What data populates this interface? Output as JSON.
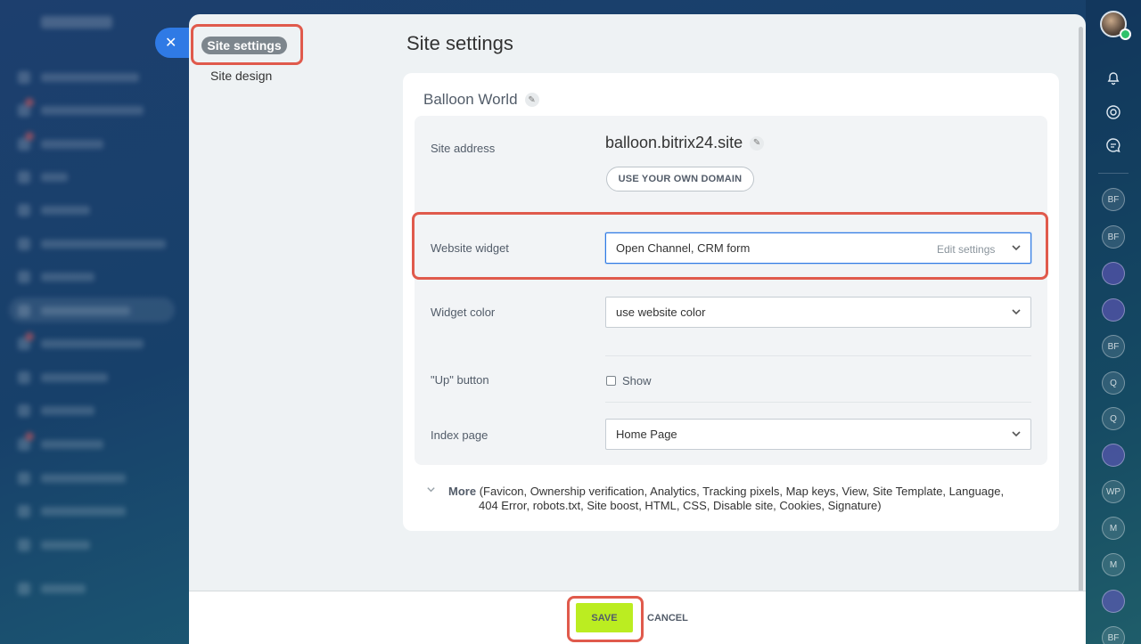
{
  "sidebar": {
    "active_label": "Site settings",
    "items": [
      {
        "label": "Site design"
      }
    ]
  },
  "page": {
    "title": "Site settings"
  },
  "site": {
    "name": "Balloon World",
    "address_label": "Site address",
    "domain": "balloon.bitrix24.site",
    "own_domain_button": "USE YOUR OWN DOMAIN"
  },
  "settings": {
    "widget": {
      "label": "Website widget",
      "value": "Open Channel, CRM form",
      "edit_link": "Edit settings"
    },
    "widget_color": {
      "label": "Widget color",
      "value": "use website color"
    },
    "up_button": {
      "label": "\"Up\" button",
      "checkbox_label": "Show",
      "checked": false
    },
    "index_page": {
      "label": "Index page",
      "value": "Home Page"
    }
  },
  "more": {
    "label": "More",
    "line1": "(Favicon,  Ownership verification,  Analytics,  Tracking pixels,  Map keys,  View,  Site Template,  Language,",
    "line2": "404 Error,  robots.txt,  Site boost,  HTML,  CSS,  Disable site,  Cookies,  Signature)"
  },
  "footer": {
    "save": "SAVE",
    "cancel": "CANCEL"
  },
  "rail": {
    "chips": [
      "BF",
      "BF",
      "",
      "",
      "BF",
      "Q",
      "Q",
      "",
      "WP",
      "M",
      "M",
      "",
      "BF"
    ]
  },
  "colors": {
    "accent": "#2f7ae5",
    "save_bg": "#bbed21",
    "highlight": "#e05a4c"
  }
}
